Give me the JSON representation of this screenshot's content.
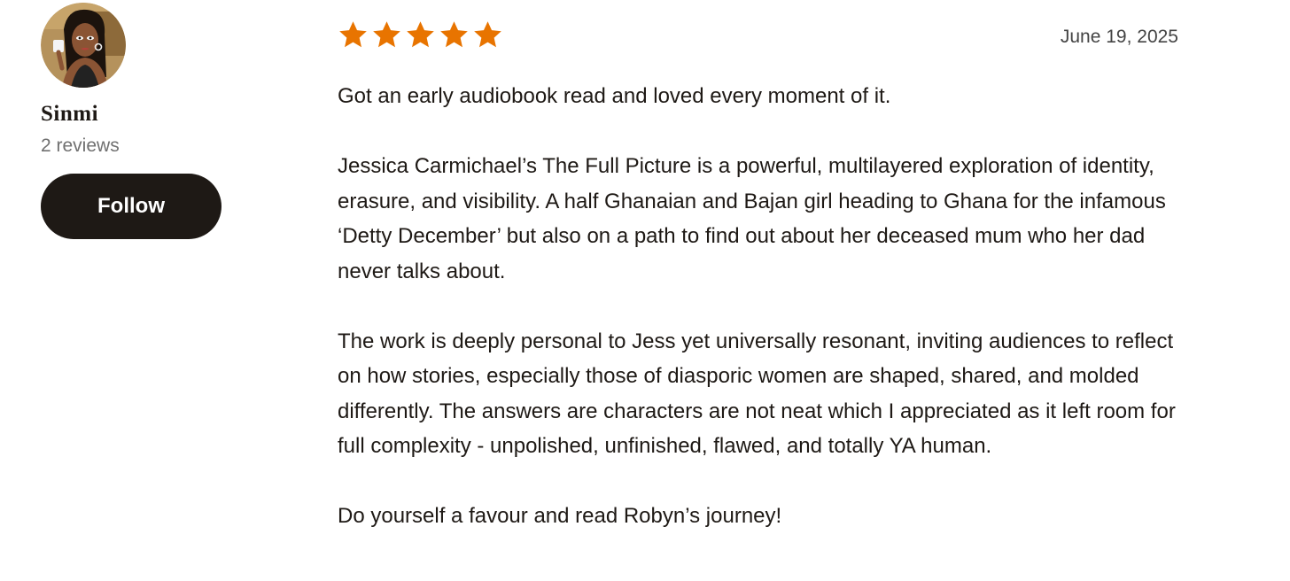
{
  "reviewer": {
    "name": "Sinmi",
    "stats": "2 reviews",
    "follow_label": "Follow"
  },
  "review": {
    "rating": 5,
    "max_rating": 5,
    "star_color": "#e87400",
    "date": "June 19, 2025",
    "paragraphs": [
      "Got an early audiobook read and loved every moment of it.",
      "Jessica Carmichael’s The Full Picture is a powerful, multilayered exploration of identity, erasure, and visibility. A half Ghanaian and Bajan girl heading to Ghana for the infamous ‘Detty December’ but also on a path to find out about her deceased mum who her dad never talks about.",
      "The work is deeply personal to Jess yet universally resonant, inviting audiences to reflect on how stories, especially those of diasporic women are shaped, shared, and molded differently. The answers are characters are not neat which I appreciated as it left room for full complexity - unpolished, unfinished, flawed, and totally YA human.",
      "Do yourself a favour and read Robyn’s journey!"
    ]
  }
}
